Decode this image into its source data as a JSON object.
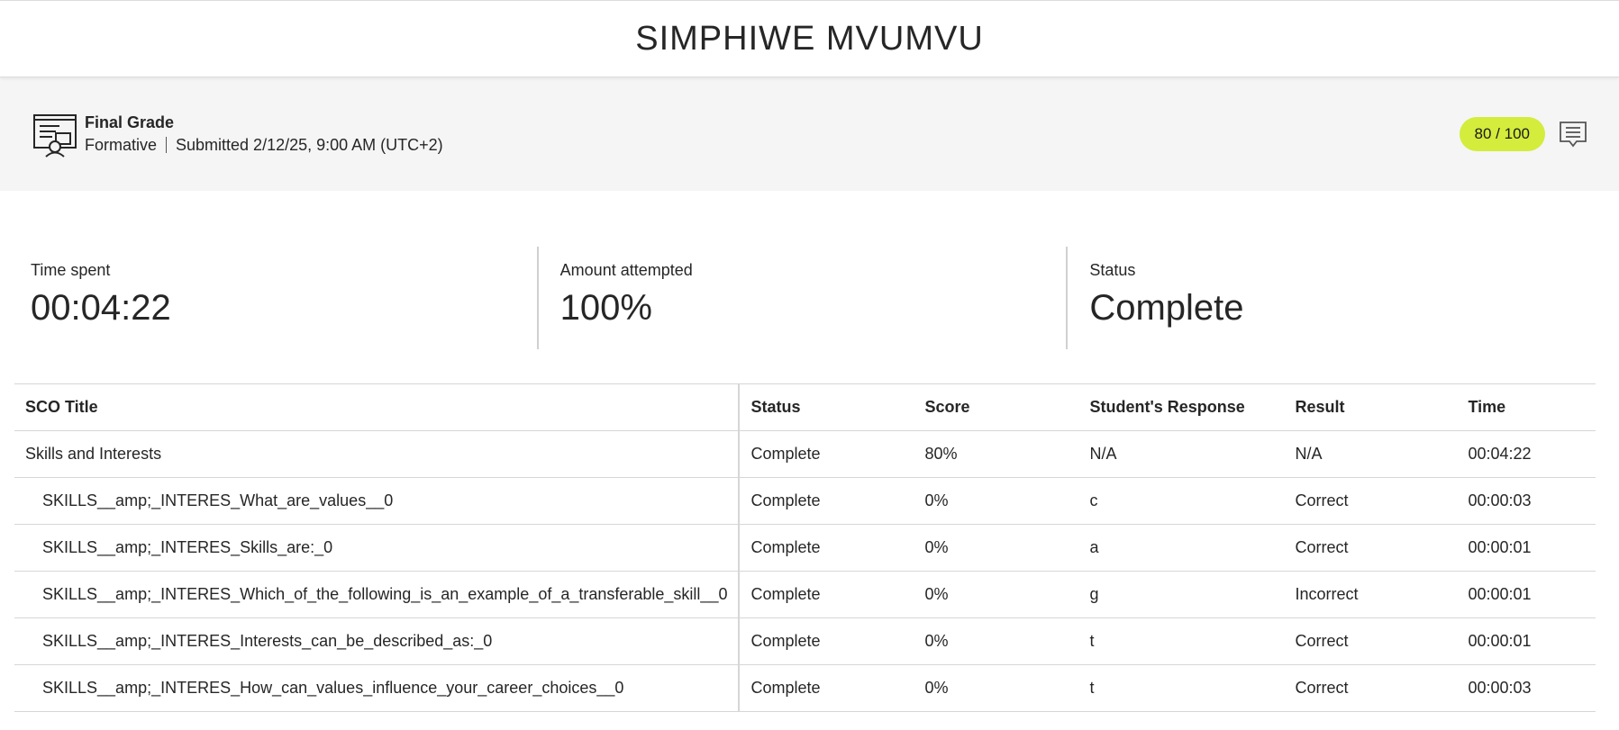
{
  "header": {
    "student_name": "SIMPHIWE MVUMVU"
  },
  "grade": {
    "title": "Final Grade",
    "type": "Formative",
    "submitted": "Submitted 2/12/25, 9:00 AM (UTC+2)",
    "score": "80 / 100",
    "icon": "presentation-icon",
    "comment_icon": "comment-icon",
    "accent_color": "#d4ec3c"
  },
  "stats": {
    "time_spent_label": "Time spent",
    "time_spent_value": "00:04:22",
    "attempted_label": "Amount attempted",
    "attempted_value": "100%",
    "status_label": "Status",
    "status_value": "Complete"
  },
  "table": {
    "headers": {
      "title": "SCO Title",
      "status": "Status",
      "score": "Score",
      "response": "Student's Response",
      "result": "Result",
      "time": "Time"
    },
    "rows": [
      {
        "title": "Skills and Interests",
        "status": "Complete",
        "score": "80%",
        "response": "N/A",
        "result": "N/A",
        "time": "00:04:22"
      },
      {
        "title": "SKILLS__amp;_INTERES_What_are_values__0",
        "status": "Complete",
        "score": "0%",
        "response": "c",
        "result": "Correct",
        "time": "00:00:03"
      },
      {
        "title": "SKILLS__amp;_INTERES_Skills_are:_0",
        "status": "Complete",
        "score": "0%",
        "response": "a",
        "result": "Correct",
        "time": "00:00:01"
      },
      {
        "title": "SKILLS__amp;_INTERES_Which_of_the_following_is_an_example_of_a_transferable_skill__0",
        "status": "Complete",
        "score": "0%",
        "response": "g",
        "result": "Incorrect",
        "time": "00:00:01"
      },
      {
        "title": "SKILLS__amp;_INTERES_Interests_can_be_described_as:_0",
        "status": "Complete",
        "score": "0%",
        "response": "t",
        "result": "Correct",
        "time": "00:00:01"
      },
      {
        "title": "SKILLS__amp;_INTERES_How_can_values_influence_your_career_choices__0",
        "status": "Complete",
        "score": "0%",
        "response": "t",
        "result": "Correct",
        "time": "00:00:03"
      }
    ]
  }
}
